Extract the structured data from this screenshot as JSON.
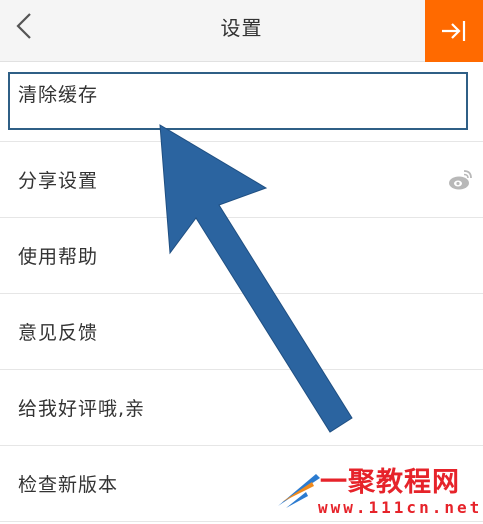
{
  "header": {
    "title": "设置",
    "back_icon": "chevron-left-icon",
    "exit_icon": "arrow-to-right-icon",
    "accent_color": "#ff6a00"
  },
  "settings": {
    "items": [
      {
        "label": "清除缓存",
        "highlighted": true
      },
      {
        "label": "分享设置",
        "right_icon": "weibo-icon"
      },
      {
        "label": "使用帮助"
      },
      {
        "label": "意见反馈"
      },
      {
        "label": "给我好评哦,亲"
      },
      {
        "label": "检查新版本"
      }
    ]
  },
  "annotation": {
    "arrow_color": "#2b64a0",
    "highlight_color": "#2f5f86"
  },
  "watermark": {
    "title": "一聚教程网",
    "url": "www.111cn.net",
    "color": "#e6232a"
  }
}
